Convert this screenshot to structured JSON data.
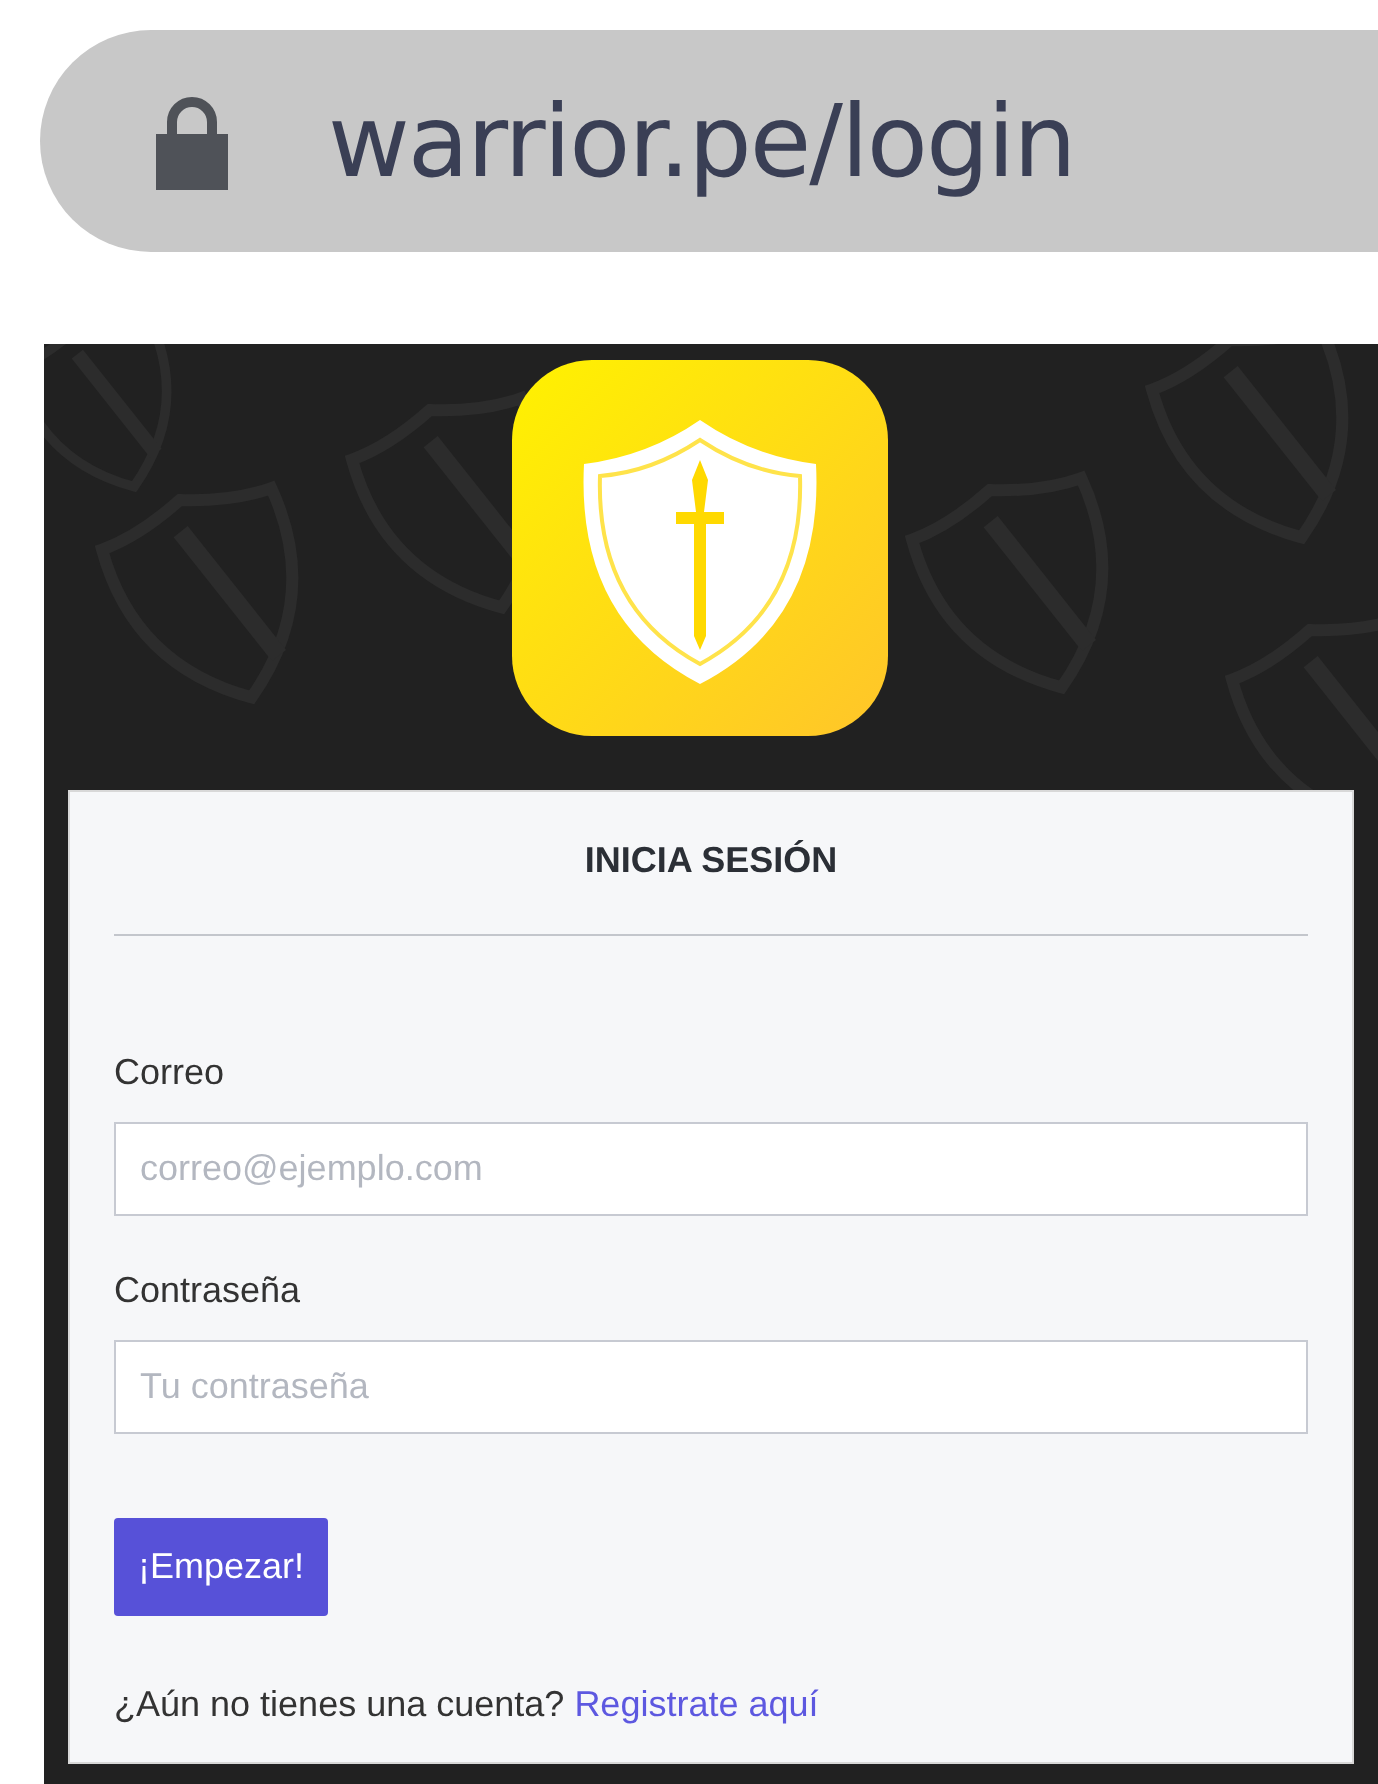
{
  "address_bar": {
    "url": "warrior.pe/login"
  },
  "login_card": {
    "title": "INICIA SESIÓN",
    "fields": [
      {
        "label": "Correo",
        "placeholder": "correo@ejemplo.com"
      },
      {
        "label": "Contraseña",
        "placeholder": "Tu contraseña"
      }
    ],
    "submit_button": "¡Empezar!",
    "footer": {
      "text": "¿Aún no tienes una cuenta?",
      "link": "Registrate aquí"
    }
  }
}
